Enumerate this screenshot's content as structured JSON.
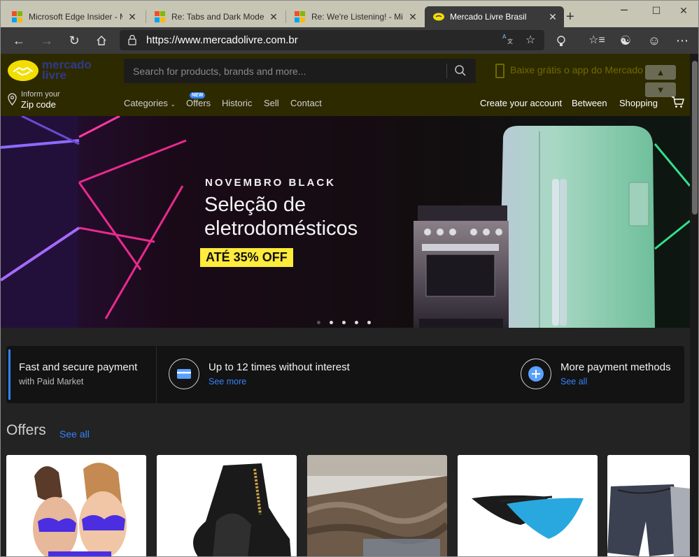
{
  "browser": {
    "tabs": [
      {
        "title": "Microsoft Edge Insider - Micr",
        "favicon": "microsoft-logo"
      },
      {
        "title": "Re: Tabs and Dark Mode - Mic",
        "favicon": "microsoft-logo"
      },
      {
        "title": "Re: We're Listening! - Microsc",
        "favicon": "microsoft-logo"
      },
      {
        "title": "Mercado Livre Brasil",
        "favicon": "mercadolivre-logo",
        "active": true
      }
    ],
    "url": "https://www.mercadolivre.com.br"
  },
  "site": {
    "logo_text_line1": "mercado",
    "logo_text_line2": "livre",
    "search_placeholder": "Search for products, brands and more...",
    "app_promo": "Baixe grátis o app do Mercado Livre!",
    "zip_line1": "Inform your",
    "zip_line2": "Zip code",
    "nav": {
      "categories": "Categories",
      "offers": "Offers",
      "offers_badge": "NEW",
      "historic": "Historic",
      "sell": "Sell",
      "contact": "Contact",
      "create_account": "Create your account",
      "between": "Between",
      "shopping": "Shopping"
    }
  },
  "hero": {
    "eyebrow": "NOVEMBRO BLACK",
    "headline_line1": "Seleção de",
    "headline_line2": "eletrodomésticos",
    "promo": "ATÉ 35% OFF",
    "slides_count": 5,
    "active_slide": 1
  },
  "payment": {
    "item1_title": "Fast and secure payment",
    "item1_sub": "with Paid Market",
    "item2_title": "Up to 12 times without interest",
    "item2_link": "See more",
    "item3_title": "More payment methods",
    "item3_link": "See all"
  },
  "offers": {
    "title": "Offers",
    "see_all": "See all",
    "products": [
      "lingerie",
      "black-ankle-boot",
      "shaggy-rug",
      "underwear-set",
      "cargo-shorts"
    ]
  },
  "colors": {
    "header_bg": "#2d2a00",
    "accent_blue": "#3483fa",
    "brand_yellow": "#f2de00",
    "promo_yellow": "#ffeb3b"
  }
}
